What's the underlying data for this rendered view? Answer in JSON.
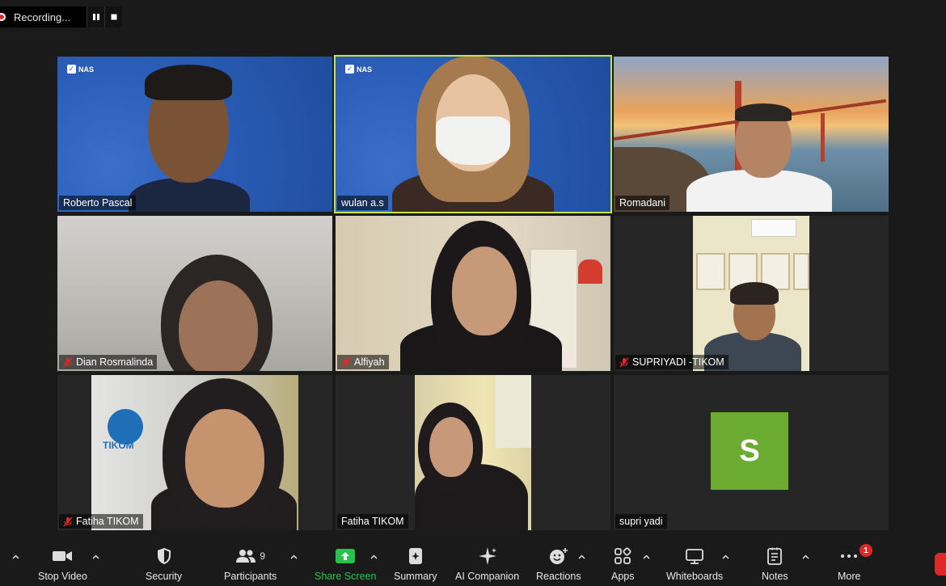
{
  "recording": {
    "label": "Recording..."
  },
  "tiles": [
    {
      "name": "Roberto Pascal",
      "brand": "NAS",
      "muted": false
    },
    {
      "name": "wulan a.s",
      "brand": "NAS",
      "muted": false,
      "active": true
    },
    {
      "name": "Romadani",
      "muted": false
    },
    {
      "name": "Dian Rosmalinda",
      "muted": true
    },
    {
      "name": "Alfiyah",
      "muted": true
    },
    {
      "name": "SUPRIYADI -TIKOM",
      "muted": true
    },
    {
      "name": "Fatiha TIKOM",
      "muted": true,
      "wall_text": "TIKOM"
    },
    {
      "name": "Fatiha TIKOM",
      "muted": false
    },
    {
      "name": "supri yadi",
      "muted": false,
      "avatar_letter": "S",
      "avatar_color": "#6bab32"
    }
  ],
  "toolbar": {
    "stop_video": "Stop Video",
    "security": "Security",
    "participants": "Participants",
    "participants_count": "9",
    "share_screen": "Share Screen",
    "summary": "Summary",
    "ai_companion": "AI Companion",
    "reactions": "Reactions",
    "apps": "Apps",
    "whiteboards": "Whiteboards",
    "notes": "Notes",
    "more": "More",
    "more_badge": "1"
  },
  "colors": {
    "active_speaker": "#c5e34a",
    "share_green": "#27c24c",
    "end_red": "#e02828",
    "nas_blue": "#2b5eb8"
  },
  "icons": [
    "pause-icon",
    "stop-icon",
    "camera-icon",
    "shield-icon",
    "people-icon",
    "share-arrow-icon",
    "summary-icon",
    "sparkle-icon",
    "reaction-icon",
    "apps-icon",
    "whiteboard-icon",
    "notes-icon",
    "more-dots-icon",
    "mic-muted-icon",
    "chevron-up-icon"
  ]
}
